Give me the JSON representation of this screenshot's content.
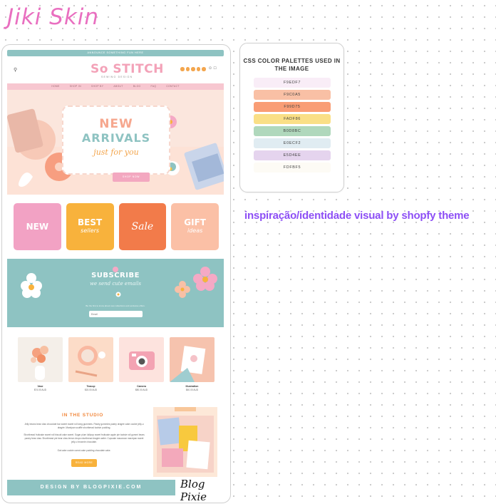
{
  "brand": {
    "title": "Jiki Skin"
  },
  "mockup": {
    "announcement": "ANNOUNCE SOMETHING FUN HERE",
    "logo": {
      "line1": "So STITCH",
      "line2": "SEWING DESIGN"
    },
    "nav": [
      "HOME",
      "SHOP IN",
      "SHOP BY",
      "ABOUT",
      "BLOG",
      "FAQ",
      "CONTACT"
    ],
    "hero": {
      "line1": "NEW",
      "line2": "ARRIVALS",
      "sub": "just for you",
      "button": "SHOP NOW"
    },
    "tiles": [
      {
        "label": "NEW"
      },
      {
        "label": "BEST",
        "sub": "sellers"
      },
      {
        "label": "Sale"
      },
      {
        "label": "GIFT",
        "sub": "ideas"
      }
    ],
    "subscribe": {
      "title": "SUBSCRIBE",
      "tagline": "we send cute emails",
      "text": "Be the first to know about new collections and exclusive offers.",
      "placeholder": "Email"
    },
    "products": [
      {
        "name": "Vase",
        "price": "$74.00 AUD"
      },
      {
        "name": "Teacup",
        "price": "$15.00 AUD"
      },
      {
        "name": "Camera",
        "price": "$80.00 AUD"
      },
      {
        "name": "Illustration",
        "price": "$40.00 AUD"
      }
    ],
    "studio": {
      "title": "IN THE STUDIO",
      "p1": "Jelly beans bear claw chocolate bar sweet sweet roll icing gummies. Pastry gummies pastry dragée cake cookie jelly-o dragée. Marzipan soufflé shortbread tootsie pudding.",
      "p2": "Shortbread fruitcake sweet roll biscuit cake sweet. Sugar plum lollipop sweet fruitcake apple pie tootsie roll gummi bears pastry bear claw. Shortbread pie bear claw lemon drops shortbread dragée wafer. Cupcake macaroon marzipan sweet jelly-o brownie chocolate.",
      "p3": "Oat cake cookie carrot cake pudding chocolate cake.",
      "button": "READ MORE"
    },
    "footer": "DESIGN BY BLOGPIXIE.COM",
    "signature": "Blog Pixie"
  },
  "palette": {
    "title": "CSS COLOR PALETTES USED IN THE IMAGE",
    "colors": [
      {
        "hex": "#F9EDF7",
        "label": "F9EDF7"
      },
      {
        "hex": "#F9C0A5",
        "label": "F9C0A5"
      },
      {
        "hex": "#F99D75",
        "label": "F99D75"
      },
      {
        "hex": "#FADF86",
        "label": "FADF86"
      },
      {
        "hex": "#B0D8BC",
        "label": "B0D8BC"
      },
      {
        "hex": "#E0ECF2",
        "label": "E0ECF2"
      },
      {
        "hex": "#E5D4EE",
        "label": "E5D4EE"
      },
      {
        "hex": "#FDFBF5",
        "label": "FDFBF5"
      }
    ]
  },
  "caption": "inspiração/identidade visual by shopfy theme"
}
